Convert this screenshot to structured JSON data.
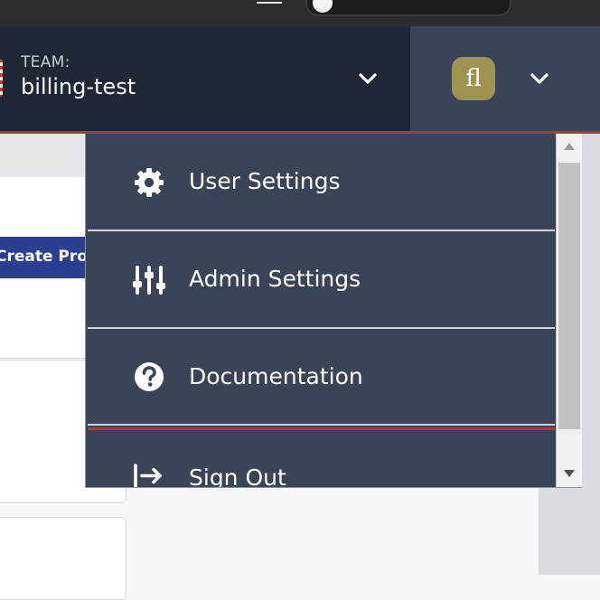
{
  "header": {
    "team_caption": "TEAM:",
    "team_name": "billing-test",
    "avatar_initials": "fl",
    "colors": {
      "header_bg": "#202838",
      "user_bg": "#394456",
      "accent_red": "#c33034",
      "avatar_bg": "#9e9351"
    }
  },
  "background": {
    "create_button_label": "Create Proj"
  },
  "user_menu": {
    "items": [
      {
        "label": "User Settings",
        "icon": "gear-icon"
      },
      {
        "label": "Admin Settings",
        "icon": "sliders-icon"
      },
      {
        "label": "Documentation",
        "icon": "question-circle-icon"
      },
      {
        "label": "Sign Out",
        "icon": "sign-out-icon"
      }
    ]
  }
}
